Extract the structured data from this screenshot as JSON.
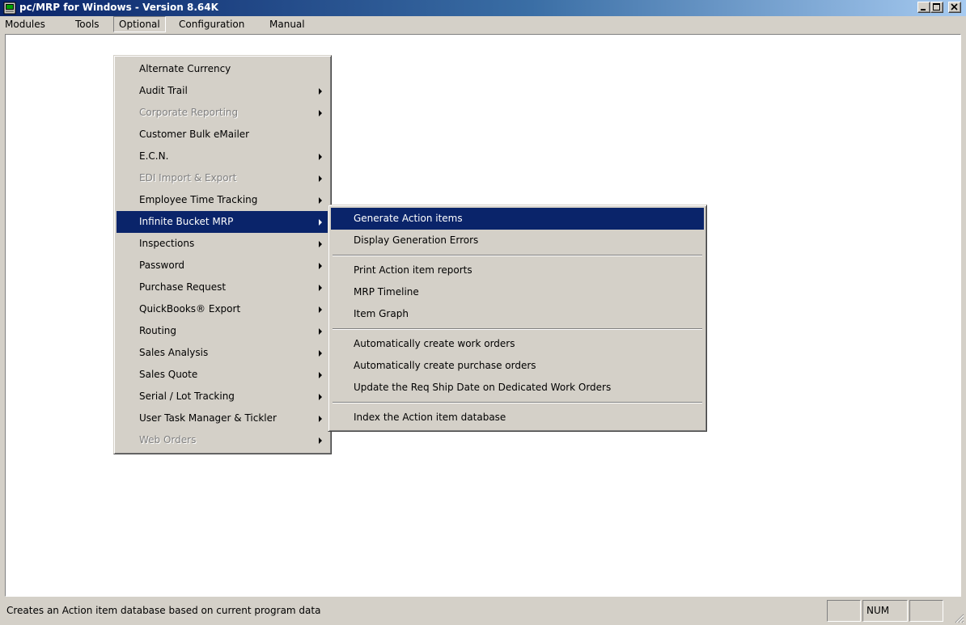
{
  "window": {
    "title": "pc/MRP for Windows - Version 8.64K"
  },
  "colors": {
    "title_bar_start": "#0a246a",
    "title_bar_end": "#a6caf0",
    "menu_highlight": "#0a246a",
    "face": "#d4d0c8"
  },
  "menubar": {
    "items": [
      "Modules",
      "Tools",
      "Optional",
      "Configuration",
      "Manual"
    ],
    "open_item": "Optional"
  },
  "optional_menu": {
    "items": [
      {
        "label": "Alternate Currency",
        "submenu": false,
        "disabled": false
      },
      {
        "label": "Audit Trail",
        "submenu": true,
        "disabled": false
      },
      {
        "label": "Corporate Reporting",
        "submenu": true,
        "disabled": true
      },
      {
        "label": "Customer Bulk eMailer",
        "submenu": false,
        "disabled": false
      },
      {
        "label": "E.C.N.",
        "submenu": true,
        "disabled": false
      },
      {
        "label": "EDI Import & Export",
        "submenu": true,
        "disabled": true
      },
      {
        "label": "Employee Time Tracking",
        "submenu": true,
        "disabled": false
      },
      {
        "label": "Infinite Bucket MRP",
        "submenu": true,
        "disabled": false,
        "selected": true
      },
      {
        "label": "Inspections",
        "submenu": true,
        "disabled": false
      },
      {
        "label": "Password",
        "submenu": true,
        "disabled": false
      },
      {
        "label": "Purchase Request",
        "submenu": true,
        "disabled": false
      },
      {
        "label": "QuickBooks® Export",
        "submenu": true,
        "disabled": false
      },
      {
        "label": "Routing",
        "submenu": true,
        "disabled": false
      },
      {
        "label": "Sales Analysis",
        "submenu": true,
        "disabled": false
      },
      {
        "label": "Sales Quote",
        "submenu": true,
        "disabled": false
      },
      {
        "label": "Serial / Lot Tracking",
        "submenu": true,
        "disabled": false
      },
      {
        "label": "User Task Manager & Tickler",
        "submenu": true,
        "disabled": false
      },
      {
        "label": "Web Orders",
        "submenu": true,
        "disabled": true
      }
    ]
  },
  "mrp_submenu": {
    "groups": [
      [
        "Generate Action items",
        "Display Generation Errors"
      ],
      [
        "Print Action item reports",
        "MRP Timeline",
        "Item Graph"
      ],
      [
        "Automatically create work orders",
        "Automatically create purchase orders",
        "Update the Req Ship Date on Dedicated Work Orders"
      ],
      [
        "Index the Action item database"
      ]
    ],
    "selected": "Generate Action items"
  },
  "statusbar": {
    "message": "Creates an Action item database based on current program data",
    "panels": [
      "",
      "NUM",
      ""
    ]
  }
}
